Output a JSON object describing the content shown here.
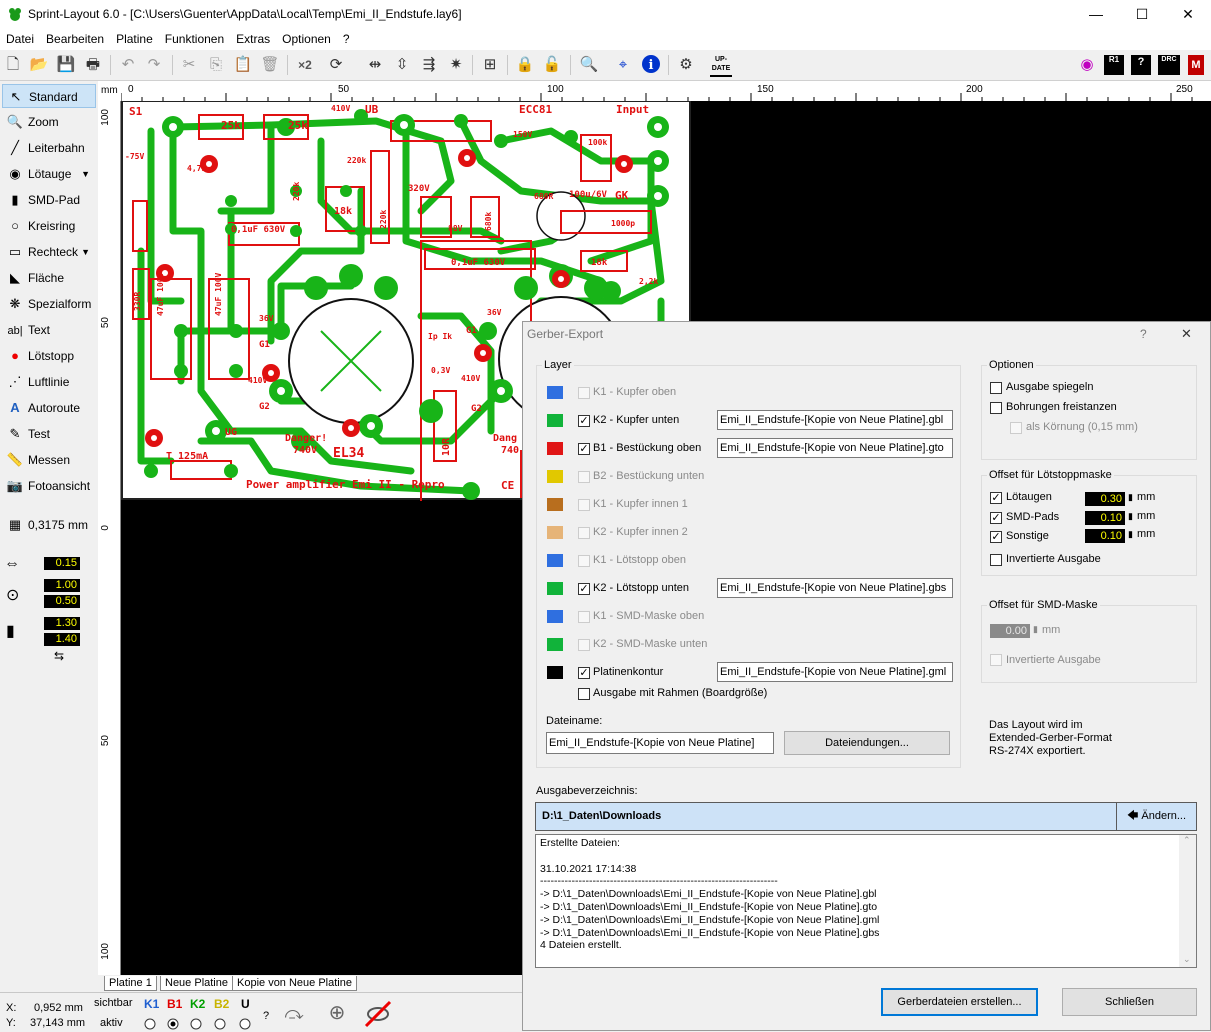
{
  "window": {
    "title": "Sprint-Layout 6.0 - [C:\\Users\\Guenter\\AppData\\Local\\Temp\\Emi_II_Endstufe.lay6]",
    "minimize": "—",
    "maximize": "☐",
    "close": "✕"
  },
  "menu": [
    "Datei",
    "Bearbeiten",
    "Platine",
    "Funktionen",
    "Extras",
    "Optionen",
    "?"
  ],
  "toolbar": {
    "badge_r1": "R1",
    "badge_drc": "DRC",
    "badge_update": "UP-DATE",
    "zoom_x2": "×2"
  },
  "tools": {
    "items": [
      {
        "label": "Standard",
        "icon": "cursor-icon"
      },
      {
        "label": "Zoom",
        "icon": "zoom-icon"
      },
      {
        "label": "Leiterbahn",
        "icon": "track-icon"
      },
      {
        "label": "Lötauge",
        "icon": "pad-icon"
      },
      {
        "label": "SMD-Pad",
        "icon": "smd-pad-icon"
      },
      {
        "label": "Kreisring",
        "icon": "ring-icon"
      },
      {
        "label": "Rechteck",
        "icon": "rectangle-icon"
      },
      {
        "label": "Fläche",
        "icon": "area-icon"
      },
      {
        "label": "Spezialform",
        "icon": "special-shape-icon"
      },
      {
        "label": "Text",
        "icon": "text-icon"
      },
      {
        "label": "Lötstopp",
        "icon": "solder-stop-icon"
      },
      {
        "label": "Luftlinie",
        "icon": "airline-icon"
      },
      {
        "label": "Autoroute",
        "icon": "autoroute-icon"
      },
      {
        "label": "Test",
        "icon": "test-icon"
      },
      {
        "label": "Messen",
        "icon": "measure-icon"
      },
      {
        "label": "Fotoansicht",
        "icon": "photo-icon"
      }
    ],
    "grid_value": "0,3175 mm",
    "track_width": "0.15",
    "pad_outer": "1.00",
    "pad_inner": "0.50",
    "smd_w": "1.30",
    "smd_h": "1.40"
  },
  "ruler": {
    "unit": "mm",
    "top_labels": [
      "0",
      "50",
      "100",
      "150",
      "200",
      "250"
    ],
    "left_labels": [
      "100",
      "50",
      "0",
      "50",
      "100"
    ]
  },
  "pcb": {
    "texts": {
      "s1": "S1",
      "ub": "UB",
      "ecc81": "ECC81",
      "input": "Input",
      "r25k_a": "25k",
      "r25k_b": "25k",
      "v410_top": "410V",
      "v150": "150V",
      "r100k": "100k",
      "v75": "-75V",
      "r47k": "4,7k",
      "r220k_a": "220k",
      "r220k_b": "220k",
      "c01uf630_a": "0,1uF 630V",
      "r18k_a": "18k",
      "v320": "320V",
      "r220_b": "220k",
      "r680": "680k",
      "v88": "88V",
      "c01uf630_b": "0,1uF 630V",
      "c100u6v": "100u/6V",
      "gk": "GK",
      "c1000p": "1000p",
      "r18k_b": "18k",
      "r22k": "2,2k",
      "r680r": "680R",
      "r330r": "330R",
      "c47uf_a": "47uF 100V",
      "c47uf_b": "47uF 100V",
      "v36_a": "36V",
      "v36_b": "36V",
      "g1_a": "G1",
      "g1_b": "G1",
      "g2_a": "G2",
      "g2_b": "G2",
      "v410_a": "410V",
      "v410_b": "410V",
      "ipk": "Ip Ik",
      "v03": "0,3V",
      "r10r": "10R",
      "danger_a": "Danger!",
      "v740_a": "740V",
      "danger_b": "Dang",
      "v740_b": "740",
      "el34": "EL34",
      "t125": "T 125mA",
      "ug": "UG",
      "footer": "Power amplifier Emi II - Repro",
      "ce": "CE"
    }
  },
  "tabs": [
    "Platine 1",
    "Neue Platine",
    "Kopie von Neue Platine"
  ],
  "status": {
    "x_label": "X:",
    "x_value": "0,952 mm",
    "y_label": "Y:",
    "y_value": "37,143 mm",
    "sichtbar": "sichtbar",
    "aktiv": "aktiv",
    "layers": [
      {
        "name": "K1",
        "color": "#1f5fd0"
      },
      {
        "name": "B1",
        "color": "#e00000"
      },
      {
        "name": "K2",
        "color": "#00a000"
      },
      {
        "name": "B2",
        "color": "#c8b400"
      },
      {
        "name": "U",
        "color": "#000000"
      }
    ],
    "help": "?"
  },
  "dialog": {
    "title": "Gerber-Export",
    "help": "?",
    "close": "✕",
    "layer_group": "Layer",
    "layers": [
      {
        "name": "K1 - Kupfer oben",
        "color": "#2f6fe0",
        "checked": false,
        "enabled": false,
        "file": ""
      },
      {
        "name": "K2 - Kupfer unten",
        "color": "#11b33a",
        "checked": true,
        "enabled": true,
        "file": "Emi_II_Endstufe-[Kopie von Neue Platine].gbl"
      },
      {
        "name": "B1 - Bestückung oben",
        "color": "#e01515",
        "checked": true,
        "enabled": true,
        "file": "Emi_II_Endstufe-[Kopie von Neue Platine].gto"
      },
      {
        "name": "B2 - Bestückung unten",
        "color": "#e1c800",
        "checked": false,
        "enabled": false,
        "file": ""
      },
      {
        "name": "K1 - Kupfer innen 1",
        "color": "#b86e1e",
        "checked": false,
        "enabled": false,
        "file": ""
      },
      {
        "name": "K2 - Kupfer innen 2",
        "color": "#e6b478",
        "checked": false,
        "enabled": false,
        "file": ""
      },
      {
        "name": "K1 - Lötstopp oben",
        "color": "#2f6fe0",
        "checked": false,
        "enabled": false,
        "file": ""
      },
      {
        "name": "K2 - Lötstopp unten",
        "color": "#11b33a",
        "checked": true,
        "enabled": true,
        "file": "Emi_II_Endstufe-[Kopie von Neue Platine].gbs"
      },
      {
        "name": "K1 - SMD-Maske oben",
        "color": "#2f6fe0",
        "checked": false,
        "enabled": false,
        "file": ""
      },
      {
        "name": "K2 - SMD-Maske unten",
        "color": "#11b33a",
        "checked": false,
        "enabled": false,
        "file": ""
      },
      {
        "name": "Platinenkontur",
        "color": "#000000",
        "checked": true,
        "enabled": true,
        "file": "Emi_II_Endstufe-[Kopie von Neue Platine].gml"
      }
    ],
    "frame_option": "Ausgabe mit Rahmen (Boardgröße)",
    "filename_label": "Dateiname:",
    "filename_value": "Emi_II_Endstufe-[Kopie von Neue Platine]",
    "file_endings_button": "Dateiendungen...",
    "options_group": "Optionen",
    "opt_mirror": "Ausgabe spiegeln",
    "opt_drill": "Bohrungen freistanzen",
    "opt_grain": "als Körnung (0,15 mm)",
    "offset_stop_group": "Offset für Lötstoppmaske",
    "stop_pads": {
      "label": "Lötaugen",
      "value": "0.30",
      "unit": "mm"
    },
    "stop_smd": {
      "label": "SMD-Pads",
      "value": "0.10",
      "unit": "mm"
    },
    "stop_other": {
      "label": "Sonstige",
      "value": "0.10",
      "unit": "mm"
    },
    "stop_inverted": "Invertierte Ausgabe",
    "offset_smd_group": "Offset für SMD-Maske",
    "smd_value": "0.00",
    "smd_unit": "mm",
    "smd_inverted": "Invertierte Ausgabe",
    "info": [
      "Das Layout wird im",
      "Extended-Gerber-Format",
      "RS-274X exportiert."
    ],
    "outdir_label": "Ausgabeverzeichnis:",
    "outdir_value": "D:\\1_Daten\\Downloads",
    "change_button": "Ändern...",
    "log": [
      "Erstellte Dateien:",
      "",
      "31.10.2021 17:14:38",
      "--------------------------------------------------------------------",
      "-> D:\\1_Daten\\Downloads\\Emi_II_Endstufe-[Kopie von Neue Platine].gbl",
      "-> D:\\1_Daten\\Downloads\\Emi_II_Endstufe-[Kopie von Neue Platine].gto",
      "-> D:\\1_Daten\\Downloads\\Emi_II_Endstufe-[Kopie von Neue Platine].gml",
      "-> D:\\1_Daten\\Downloads\\Emi_II_Endstufe-[Kopie von Neue Platine].gbs",
      "4 Dateien erstellt."
    ],
    "create_button": "Gerberdateien erstellen...",
    "close_button": "Schließen"
  }
}
